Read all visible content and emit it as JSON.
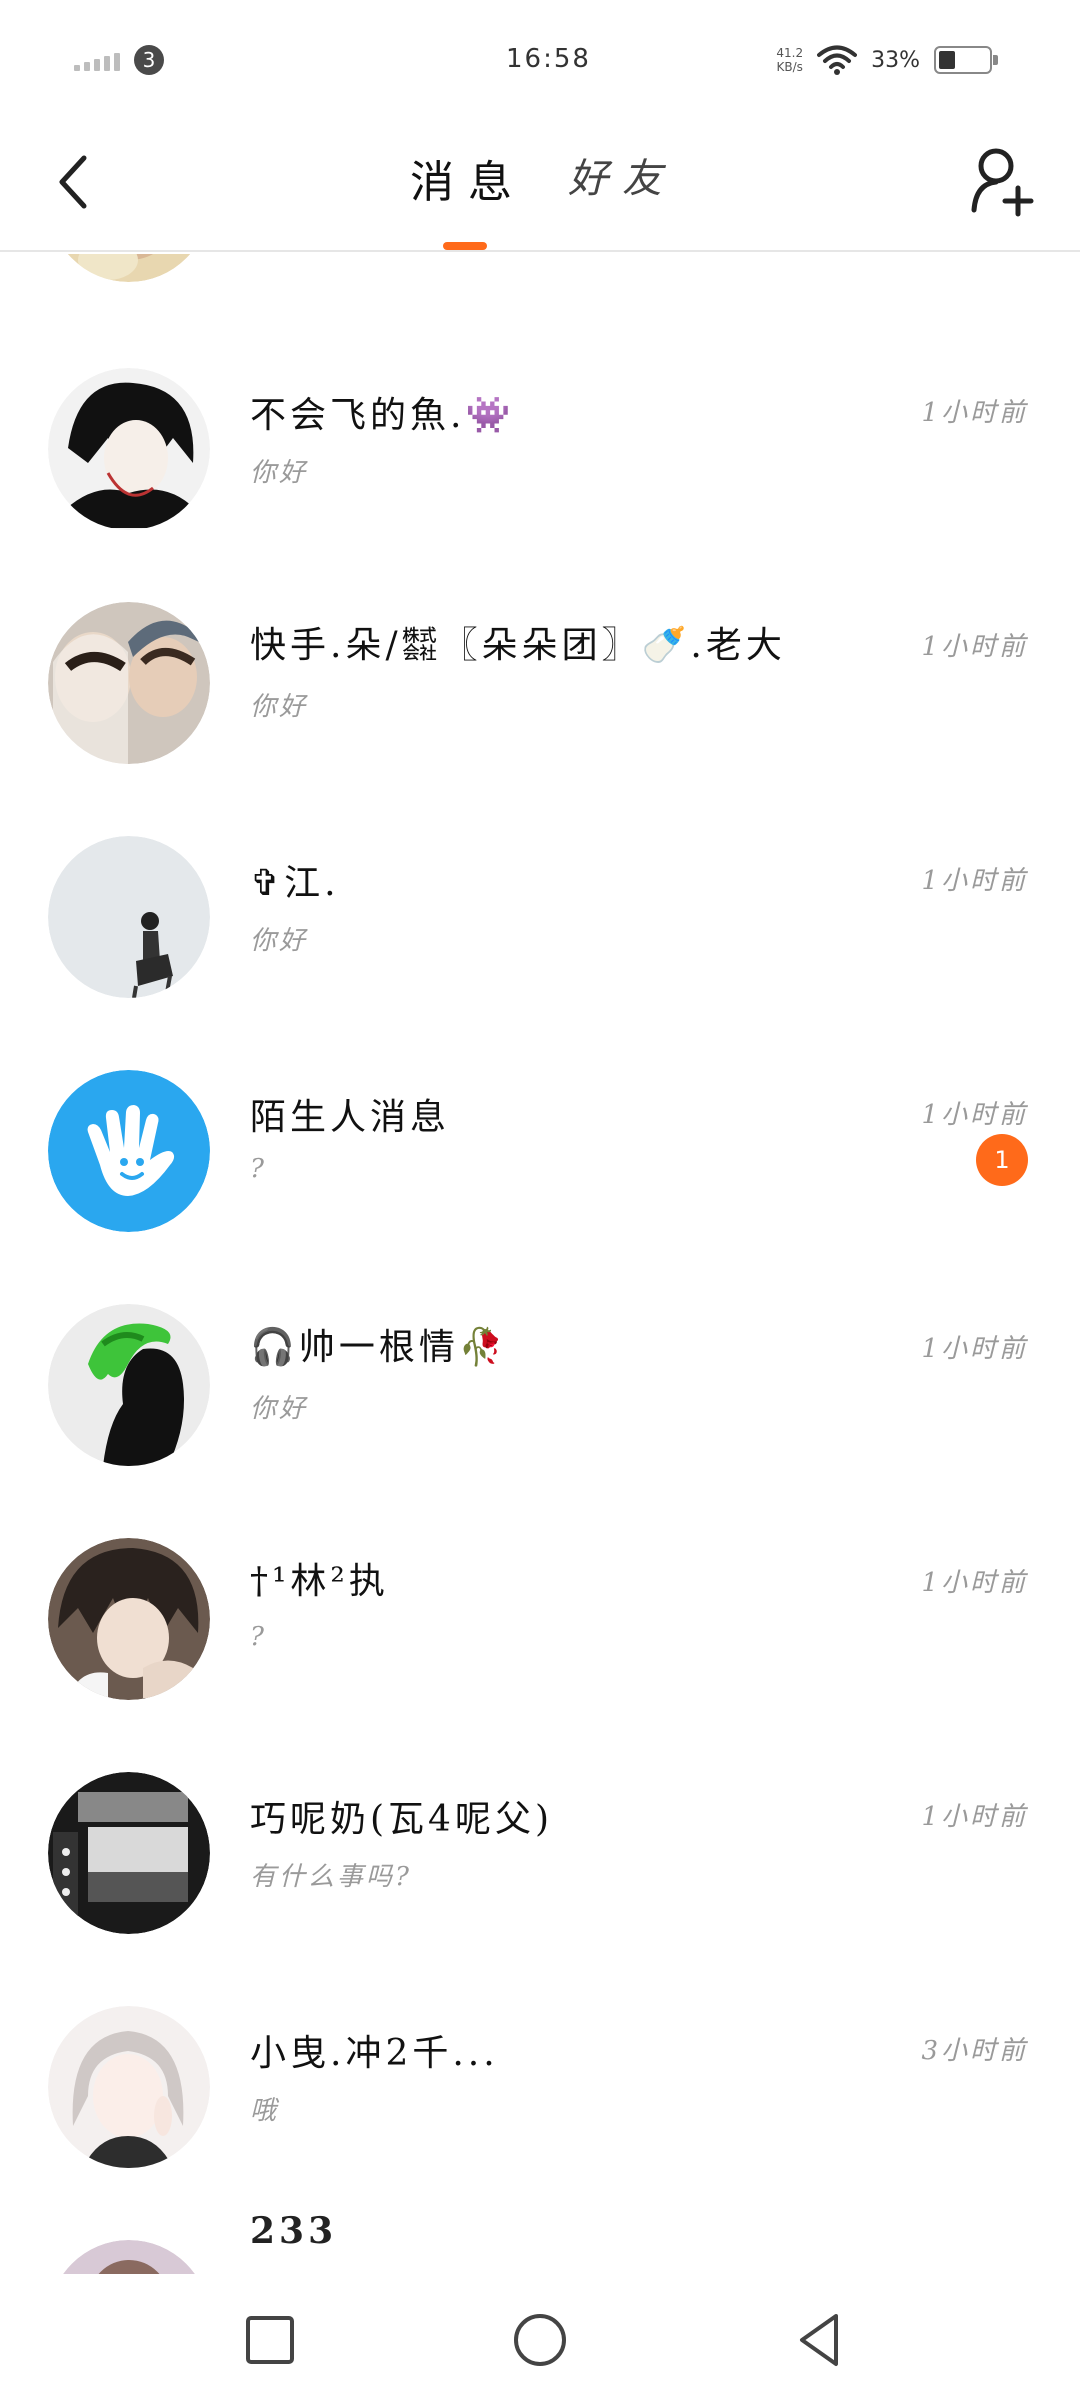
{
  "status_bar": {
    "sim_badge": "3",
    "time": "16:58",
    "net_speed_value": "41.2",
    "net_speed_unit": "KB/s",
    "battery_pct": "33%",
    "battery_level": 0.33
  },
  "header": {
    "tabs": [
      {
        "label": "消息",
        "active": true
      },
      {
        "label": "好友",
        "active": false
      }
    ],
    "accent_color": "#ff6a1a"
  },
  "conversations": [
    {
      "name": "",
      "preview": "",
      "time": "",
      "avatar": "partial-top"
    },
    {
      "name": "不会飞的魚.👾",
      "preview": "你好",
      "time": "1小时前",
      "avatar": "dark-hair-boy"
    },
    {
      "name": "快手.朵/㍿〖朵朵团〗🍼.老大",
      "preview": "你好",
      "time": "1小时前",
      "avatar": "two-people-photo"
    },
    {
      "name": "✞江.",
      "preview": "你好",
      "time": "1小时前",
      "avatar": "silhouette-grey"
    },
    {
      "name": "陌生人消息",
      "preview": "?",
      "time": "1小时前",
      "avatar": "stranger-hand-icon",
      "unread": "1"
    },
    {
      "name": "🎧帅一根情🥀",
      "preview": "你好",
      "time": "1小时前",
      "avatar": "green-hair-silhouette"
    },
    {
      "name": "†¹林²执",
      "preview": "?",
      "time": "1小时前",
      "avatar": "anime-boy"
    },
    {
      "name": "巧呢奶(瓦4呢父)",
      "preview": "有什么事吗?",
      "time": "1小时前",
      "avatar": "concert-photo"
    },
    {
      "name": "小曳.冲2千...",
      "preview": "哦",
      "time": "3小时前",
      "avatar": "girl-photo"
    },
    {
      "name": "233",
      "preview": "",
      "time": "",
      "avatar": "partial-bottom"
    }
  ]
}
